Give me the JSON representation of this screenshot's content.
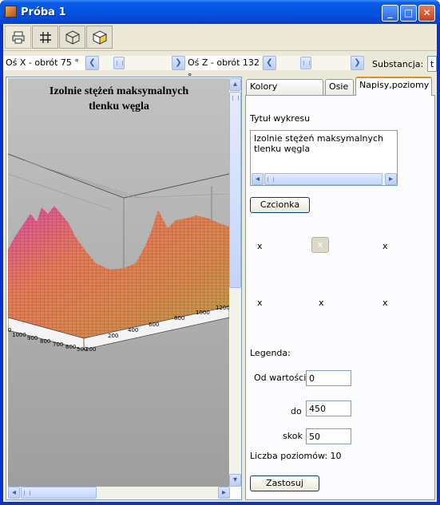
{
  "window": {
    "title": "Próba 1",
    "minimize": "_",
    "maximize": "□",
    "close": "✕"
  },
  "toolbar": [
    {
      "icon": "printer-icon",
      "glyph": "🖶"
    },
    {
      "icon": "grid-icon",
      "glyph": "#"
    },
    {
      "icon": "wireframe-box-icon",
      "glyph": "⬡"
    },
    {
      "icon": "shaded-box-icon",
      "glyph": "⬢"
    }
  ],
  "sliders": {
    "x_label": "Oś X - obrót 75 °",
    "z_label": "Oś Z - obrót 132 °",
    "substance_label": "Substancja:",
    "substance_value": "t",
    "x_value": 75,
    "z_value": 132
  },
  "plot": {
    "title_line1": "Izolnie stężeń maksymalnych",
    "title_line2": "tlenku węgla",
    "x_ticks": [
      "0",
      "1000",
      "900",
      "800",
      "700",
      "600",
      "500",
      "200"
    ],
    "y_ticks": [
      "200",
      "400",
      "600",
      "800",
      "1000",
      "1200",
      "1400",
      "1600",
      "1800",
      "2000"
    ]
  },
  "tabs": [
    {
      "label": "Kolory powierzchni",
      "active": false
    },
    {
      "label": "Osie",
      "active": false
    },
    {
      "label": "Napisy,poziomy",
      "active": true
    }
  ],
  "napisy": {
    "chart_title_label": "Tytuł wykresu",
    "chart_title_text": "Izolnie stężeń maksymalnych tlenku węgla",
    "font_button": "Czcionka",
    "x_row1": [
      "x",
      "x",
      "x"
    ],
    "x_row2": [
      "x",
      "x",
      "x"
    ],
    "legend_label": "Legenda:",
    "from_label": "Od wartości",
    "from_value": "0",
    "to_label": "do",
    "to_value": "450",
    "step_label": "skok",
    "step_value": "50",
    "levels_text": "Liczba poziomów: 10",
    "apply_button": "Zastosuj"
  }
}
